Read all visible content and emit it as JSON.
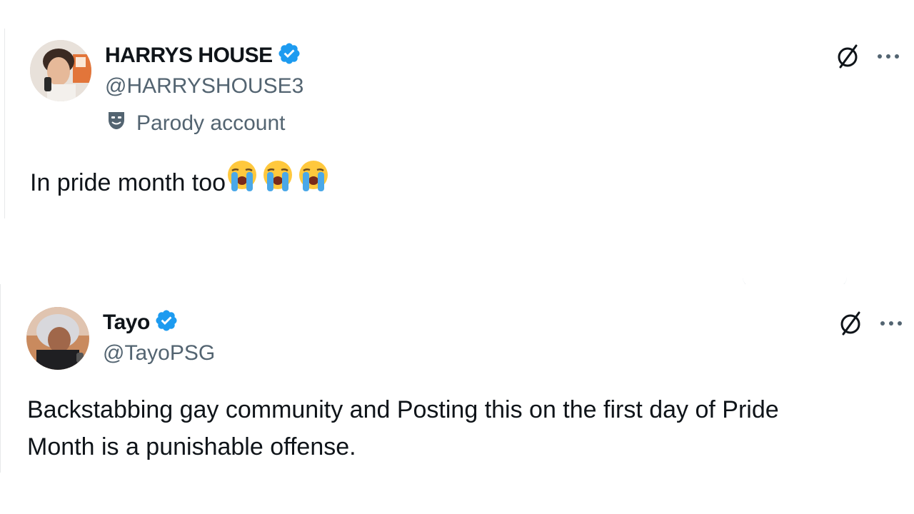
{
  "tweets": [
    {
      "display_name": "HARRYS HOUSE",
      "handle": "@HARRYSHOUSE3",
      "label": "Parody account",
      "text": "In pride month too",
      "emoji_count": 3,
      "emoji_name": "loudly-crying-face",
      "verified": true,
      "icons": [
        "grok-icon",
        "more-icon"
      ]
    },
    {
      "display_name": "Tayo",
      "handle": "@TayoPSG",
      "text_lines": [
        "Backstabbing gay community and Posting this on the first day of Pride",
        "Month is a punishable offense."
      ],
      "verified": true,
      "icons": [
        "grok-icon",
        "more-icon"
      ]
    }
  ],
  "colors": {
    "verified_blue": "#1d9bf0",
    "text_primary": "#0f1419",
    "text_secondary": "#536471",
    "emoji_yellow": "#ffc83d"
  }
}
